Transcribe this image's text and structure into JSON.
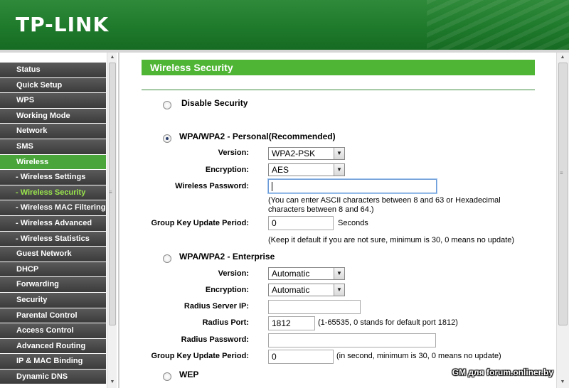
{
  "header": {
    "logo": "TP-LINK"
  },
  "sidebar": {
    "items": [
      {
        "label": "Status",
        "type": "main",
        "state": "normal"
      },
      {
        "label": "Quick Setup",
        "type": "main",
        "state": "normal"
      },
      {
        "label": "WPS",
        "type": "main",
        "state": "normal"
      },
      {
        "label": "Working Mode",
        "type": "main",
        "state": "normal"
      },
      {
        "label": "Network",
        "type": "main",
        "state": "normal"
      },
      {
        "label": "SMS",
        "type": "main",
        "state": "normal"
      },
      {
        "label": "Wireless",
        "type": "main",
        "state": "active"
      },
      {
        "label": "- Wireless Settings",
        "type": "sub",
        "state": "normal"
      },
      {
        "label": "- Wireless Security",
        "type": "sub",
        "state": "current"
      },
      {
        "label": "- Wireless MAC Filtering",
        "type": "sub",
        "state": "normal"
      },
      {
        "label": "- Wireless Advanced",
        "type": "sub",
        "state": "normal"
      },
      {
        "label": "- Wireless Statistics",
        "type": "sub",
        "state": "normal"
      },
      {
        "label": "Guest Network",
        "type": "main",
        "state": "normal"
      },
      {
        "label": "DHCP",
        "type": "main",
        "state": "normal"
      },
      {
        "label": "Forwarding",
        "type": "main",
        "state": "normal"
      },
      {
        "label": "Security",
        "type": "main",
        "state": "normal"
      },
      {
        "label": "Parental Control",
        "type": "main",
        "state": "normal"
      },
      {
        "label": "Access Control",
        "type": "main",
        "state": "normal"
      },
      {
        "label": "Advanced Routing",
        "type": "main",
        "state": "normal"
      },
      {
        "label": "IP & MAC Binding",
        "type": "main",
        "state": "normal"
      },
      {
        "label": "Dynamic DNS",
        "type": "main",
        "state": "normal"
      }
    ]
  },
  "main": {
    "title": "Wireless Security",
    "disable": {
      "label": "Disable Security",
      "checked": false
    },
    "personal": {
      "label": "WPA/WPA2 - Personal(Recommended)",
      "checked": true,
      "version_label": "Version:",
      "version_value": "WPA2-PSK",
      "encryption_label": "Encryption:",
      "encryption_value": "AES",
      "password_label": "Wireless Password:",
      "password_value": "",
      "password_hint_1": "(You can enter ASCII characters between 8 and 63 or Hexadecimal",
      "password_hint_2": "characters between 8 and 64.)",
      "gkup_label": "Group Key Update Period:",
      "gkup_value": "0",
      "gkup_unit": "Seconds",
      "gkup_hint": "(Keep it default if you are not sure, minimum is 30, 0 means no update)"
    },
    "enterprise": {
      "label": "WPA/WPA2 - Enterprise",
      "checked": false,
      "version_label": "Version:",
      "version_value": "Automatic",
      "encryption_label": "Encryption:",
      "encryption_value": "Automatic",
      "radius_ip_label": "Radius Server IP:",
      "radius_ip_value": "",
      "radius_port_label": "Radius Port:",
      "radius_port_value": "1812",
      "radius_port_hint": "(1-65535, 0 stands for default port 1812)",
      "radius_pw_label": "Radius Password:",
      "radius_pw_value": "",
      "gkup_label": "Group Key Update Period:",
      "gkup_value": "0",
      "gkup_hint": "(in second, minimum is 30, 0 means no update)"
    },
    "wep": {
      "label": "WEP",
      "checked": false
    }
  },
  "watermark": "GM для forum.onliner.by",
  "colors": {
    "brand_green": "#1f7a2c",
    "section_green": "#4fb534",
    "menu_gray": "#4a4a4a",
    "active_sub": "#9ae64c"
  }
}
